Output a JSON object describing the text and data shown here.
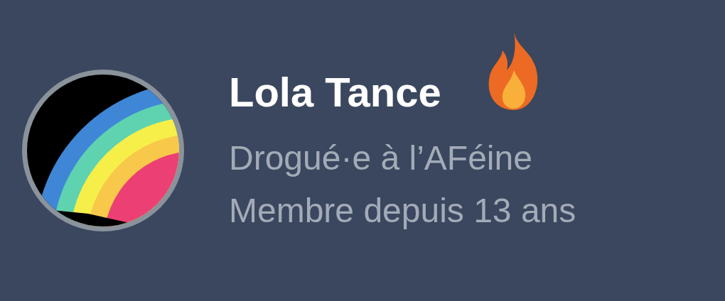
{
  "profile": {
    "name": "Lola Tance",
    "title": "Drogué·e à l’AFéine",
    "member_since": "Membre depuis 13 ans"
  }
}
